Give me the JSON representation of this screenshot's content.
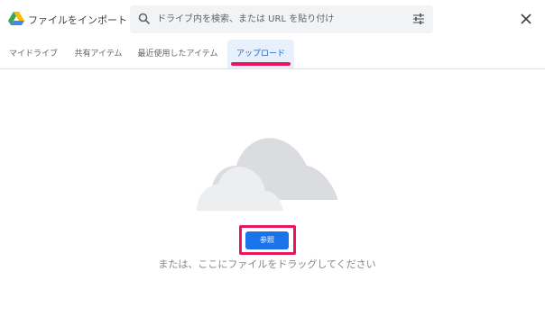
{
  "header": {
    "title": "ファイルをインポート",
    "search_placeholder": "ドライブ内を検索、または URL を貼り付け"
  },
  "tabs": [
    {
      "label": "マイドライブ",
      "active": false
    },
    {
      "label": "共有アイテム",
      "active": false
    },
    {
      "label": "最近使用したアイテム",
      "active": false
    },
    {
      "label": "アップロード",
      "active": true
    }
  ],
  "upload": {
    "browse_label": "参照",
    "drop_text": "または、ここにファイルをドラッグしてください"
  },
  "icons": {
    "logo": "google-drive-logo",
    "search": "search-icon",
    "filter": "tune-icon",
    "close": "close-icon",
    "illustration": "cloud-illustration"
  },
  "colors": {
    "accent": "#1a73e8",
    "active_tab_bg": "#e8f0fe",
    "active_tab_text": "#1967d2",
    "highlight": "#e8175d",
    "cloud_dark": "#dadce0",
    "cloud_light": "#eceef0"
  }
}
